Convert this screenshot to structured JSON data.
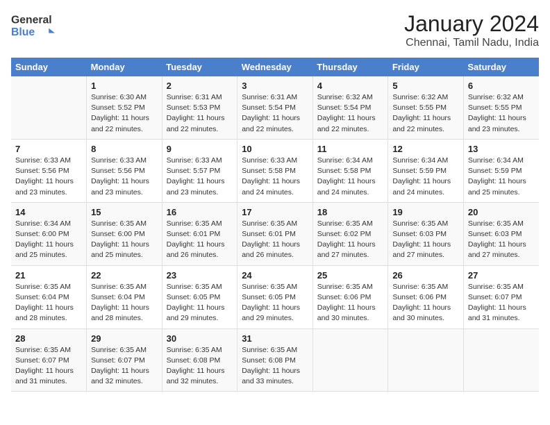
{
  "header": {
    "logo_line1": "General",
    "logo_line2": "Blue",
    "title": "January 2024",
    "subtitle": "Chennai, Tamil Nadu, India"
  },
  "days_of_week": [
    "Sunday",
    "Monday",
    "Tuesday",
    "Wednesday",
    "Thursday",
    "Friday",
    "Saturday"
  ],
  "weeks": [
    [
      {
        "num": "",
        "info": ""
      },
      {
        "num": "1",
        "info": "Sunrise: 6:30 AM\nSunset: 5:52 PM\nDaylight: 11 hours\nand 22 minutes."
      },
      {
        "num": "2",
        "info": "Sunrise: 6:31 AM\nSunset: 5:53 PM\nDaylight: 11 hours\nand 22 minutes."
      },
      {
        "num": "3",
        "info": "Sunrise: 6:31 AM\nSunset: 5:54 PM\nDaylight: 11 hours\nand 22 minutes."
      },
      {
        "num": "4",
        "info": "Sunrise: 6:32 AM\nSunset: 5:54 PM\nDaylight: 11 hours\nand 22 minutes."
      },
      {
        "num": "5",
        "info": "Sunrise: 6:32 AM\nSunset: 5:55 PM\nDaylight: 11 hours\nand 22 minutes."
      },
      {
        "num": "6",
        "info": "Sunrise: 6:32 AM\nSunset: 5:55 PM\nDaylight: 11 hours\nand 23 minutes."
      }
    ],
    [
      {
        "num": "7",
        "info": "Sunrise: 6:33 AM\nSunset: 5:56 PM\nDaylight: 11 hours\nand 23 minutes."
      },
      {
        "num": "8",
        "info": "Sunrise: 6:33 AM\nSunset: 5:56 PM\nDaylight: 11 hours\nand 23 minutes."
      },
      {
        "num": "9",
        "info": "Sunrise: 6:33 AM\nSunset: 5:57 PM\nDaylight: 11 hours\nand 23 minutes."
      },
      {
        "num": "10",
        "info": "Sunrise: 6:33 AM\nSunset: 5:58 PM\nDaylight: 11 hours\nand 24 minutes."
      },
      {
        "num": "11",
        "info": "Sunrise: 6:34 AM\nSunset: 5:58 PM\nDaylight: 11 hours\nand 24 minutes."
      },
      {
        "num": "12",
        "info": "Sunrise: 6:34 AM\nSunset: 5:59 PM\nDaylight: 11 hours\nand 24 minutes."
      },
      {
        "num": "13",
        "info": "Sunrise: 6:34 AM\nSunset: 5:59 PM\nDaylight: 11 hours\nand 25 minutes."
      }
    ],
    [
      {
        "num": "14",
        "info": "Sunrise: 6:34 AM\nSunset: 6:00 PM\nDaylight: 11 hours\nand 25 minutes."
      },
      {
        "num": "15",
        "info": "Sunrise: 6:35 AM\nSunset: 6:00 PM\nDaylight: 11 hours\nand 25 minutes."
      },
      {
        "num": "16",
        "info": "Sunrise: 6:35 AM\nSunset: 6:01 PM\nDaylight: 11 hours\nand 26 minutes."
      },
      {
        "num": "17",
        "info": "Sunrise: 6:35 AM\nSunset: 6:01 PM\nDaylight: 11 hours\nand 26 minutes."
      },
      {
        "num": "18",
        "info": "Sunrise: 6:35 AM\nSunset: 6:02 PM\nDaylight: 11 hours\nand 27 minutes."
      },
      {
        "num": "19",
        "info": "Sunrise: 6:35 AM\nSunset: 6:03 PM\nDaylight: 11 hours\nand 27 minutes."
      },
      {
        "num": "20",
        "info": "Sunrise: 6:35 AM\nSunset: 6:03 PM\nDaylight: 11 hours\nand 27 minutes."
      }
    ],
    [
      {
        "num": "21",
        "info": "Sunrise: 6:35 AM\nSunset: 6:04 PM\nDaylight: 11 hours\nand 28 minutes."
      },
      {
        "num": "22",
        "info": "Sunrise: 6:35 AM\nSunset: 6:04 PM\nDaylight: 11 hours\nand 28 minutes."
      },
      {
        "num": "23",
        "info": "Sunrise: 6:35 AM\nSunset: 6:05 PM\nDaylight: 11 hours\nand 29 minutes."
      },
      {
        "num": "24",
        "info": "Sunrise: 6:35 AM\nSunset: 6:05 PM\nDaylight: 11 hours\nand 29 minutes."
      },
      {
        "num": "25",
        "info": "Sunrise: 6:35 AM\nSunset: 6:06 PM\nDaylight: 11 hours\nand 30 minutes."
      },
      {
        "num": "26",
        "info": "Sunrise: 6:35 AM\nSunset: 6:06 PM\nDaylight: 11 hours\nand 30 minutes."
      },
      {
        "num": "27",
        "info": "Sunrise: 6:35 AM\nSunset: 6:07 PM\nDaylight: 11 hours\nand 31 minutes."
      }
    ],
    [
      {
        "num": "28",
        "info": "Sunrise: 6:35 AM\nSunset: 6:07 PM\nDaylight: 11 hours\nand 31 minutes."
      },
      {
        "num": "29",
        "info": "Sunrise: 6:35 AM\nSunset: 6:07 PM\nDaylight: 11 hours\nand 32 minutes."
      },
      {
        "num": "30",
        "info": "Sunrise: 6:35 AM\nSunset: 6:08 PM\nDaylight: 11 hours\nand 32 minutes."
      },
      {
        "num": "31",
        "info": "Sunrise: 6:35 AM\nSunset: 6:08 PM\nDaylight: 11 hours\nand 33 minutes."
      },
      {
        "num": "",
        "info": ""
      },
      {
        "num": "",
        "info": ""
      },
      {
        "num": "",
        "info": ""
      }
    ]
  ]
}
